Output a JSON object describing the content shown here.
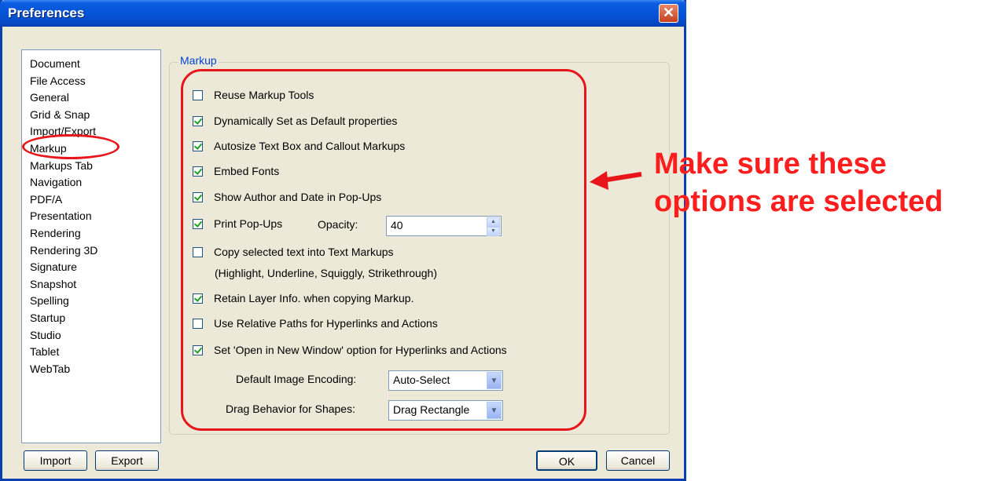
{
  "window": {
    "title": "Preferences",
    "close_glyph": "✕"
  },
  "sidebar": {
    "items": [
      "Document",
      "File Access",
      "General",
      "Grid & Snap",
      "Import/Export",
      "Markup",
      "Markups Tab",
      "Navigation",
      "PDF/A",
      "Presentation",
      "Rendering",
      "Rendering 3D",
      "Signature",
      "Snapshot",
      "Spelling",
      "Startup",
      "Studio",
      "Tablet",
      "WebTab"
    ],
    "selected": "Markup"
  },
  "markup_group": {
    "legend": "Markup",
    "options": [
      {
        "label": "Reuse Markup Tools",
        "checked": false
      },
      {
        "label": "Dynamically Set as Default properties",
        "checked": true
      },
      {
        "label": "Autosize Text Box and Callout Markups",
        "checked": true
      },
      {
        "label": "Embed Fonts",
        "checked": true
      },
      {
        "label": "Show Author and Date in Pop-Ups",
        "checked": true
      },
      {
        "label": "Print Pop-Ups",
        "checked": true
      },
      {
        "label": "Copy selected text into Text Markups",
        "checked": false
      },
      {
        "label": "Retain Layer Info. when copying Markup.",
        "checked": true
      },
      {
        "label": "Use Relative Paths for Hyperlinks and Actions",
        "checked": false
      },
      {
        "label": "Set 'Open in New Window' option for Hyperlinks and Actions",
        "checked": true
      }
    ],
    "copy_note": "(Highlight, Underline, Squiggly, Strikethrough)",
    "opacity_label": "Opacity:",
    "opacity_value": "40",
    "image_encoding_label": "Default Image Encoding:",
    "image_encoding_value": "Auto-Select",
    "drag_behavior_label": "Drag Behavior for Shapes:",
    "drag_behavior_value": "Drag Rectangle"
  },
  "buttons": {
    "import": "Import",
    "export": "Export",
    "ok": "OK",
    "cancel": "Cancel"
  },
  "annotation": {
    "line1": "Make sure these",
    "line2": "options are selected",
    "color": "#ff1d1d"
  }
}
